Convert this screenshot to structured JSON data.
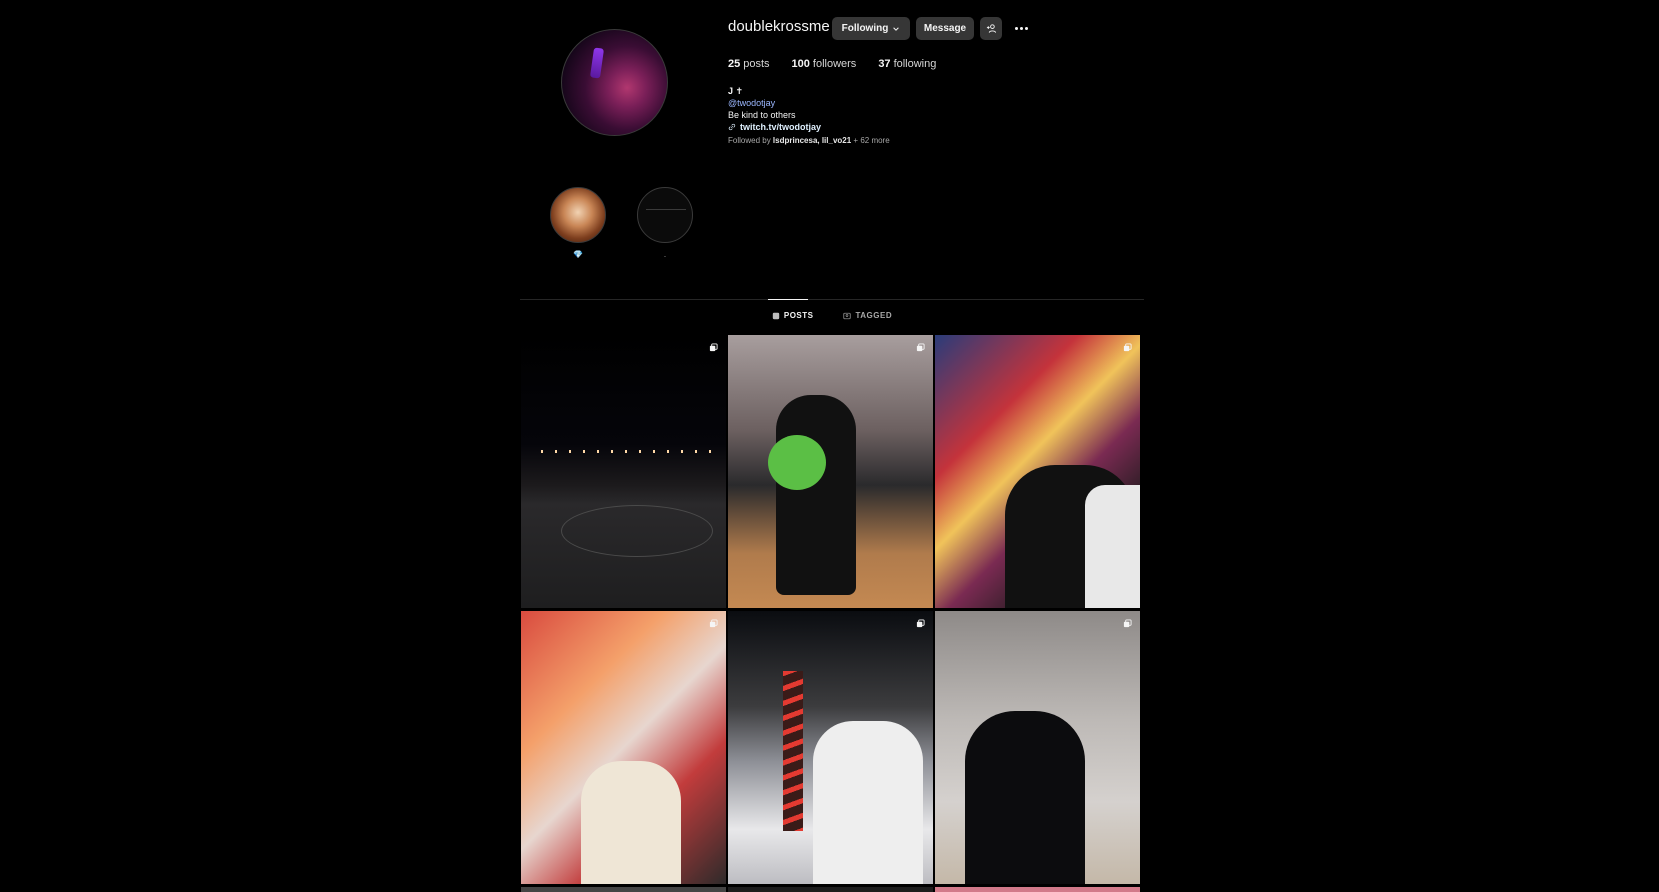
{
  "profile": {
    "username": "doublekrossme",
    "following_button": "Following",
    "message_button": "Message",
    "suggest_icon": "person-plus-icon",
    "more_icon": "more-dots-icon",
    "stats": {
      "posts_count": "25",
      "posts_label": "posts",
      "followers_count": "100",
      "followers_label": "followers",
      "following_count": "37",
      "following_label": "following"
    },
    "bio": {
      "name": "J ✝",
      "mention": "@twodotjay",
      "text": "Be kind to others",
      "link": "twitch.tv/twodotjay"
    },
    "followed_by": {
      "prefix": "Followed by",
      "names": "lsdprincesa, lil_vo21",
      "suffix": "+ 62 more"
    }
  },
  "highlights": [
    {
      "label": "💎"
    },
    {
      "label": "."
    }
  ],
  "tabs": [
    {
      "label": "POSTS",
      "active": true
    },
    {
      "label": "TAGGED",
      "active": false
    }
  ],
  "colors": {
    "background": "#000000",
    "button": "#363636",
    "mention": "#9bb7ff"
  }
}
